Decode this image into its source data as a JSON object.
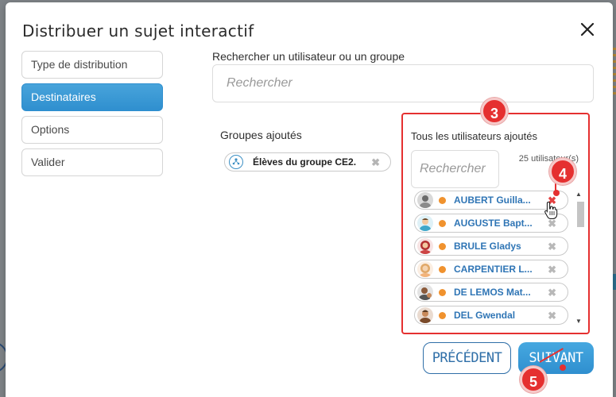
{
  "modal": {
    "title": "Distribuer un sujet interactif"
  },
  "steps": [
    {
      "label": "Type de distribution",
      "active": false
    },
    {
      "label": "Destinataires",
      "active": true
    },
    {
      "label": "Options",
      "active": false
    },
    {
      "label": "Valider",
      "active": false
    }
  ],
  "search": {
    "label": "Rechercher un utilisateur ou un groupe",
    "placeholder": "Rechercher"
  },
  "groups": {
    "label": "Groupes ajoutés",
    "items": [
      {
        "name": "Élèves du groupe CE2."
      }
    ]
  },
  "users": {
    "label": "Tous les utilisateurs ajoutés",
    "search_placeholder": "Rechercher",
    "count": "25 utilisateur(s)",
    "items": [
      {
        "name": "AUBERT Guilla...",
        "status_color": "#f0922e"
      },
      {
        "name": "AUGUSTE Bapt...",
        "status_color": "#f0922e"
      },
      {
        "name": "BRULE Gladys",
        "status_color": "#f0922e"
      },
      {
        "name": "CARPENTIER L...",
        "status_color": "#f0922e"
      },
      {
        "name": "DE LEMOS Mat...",
        "status_color": "#f0922e"
      },
      {
        "name": "DEL Gwendal",
        "status_color": "#f0922e"
      }
    ]
  },
  "annotations": {
    "badge_3": "3",
    "badge_4": "4",
    "badge_5": "5"
  },
  "footer": {
    "prev_label": "PRÉCÉDENT",
    "next_label": "SUIVANT"
  },
  "colors": {
    "accent": "#2f8fcf",
    "annotation": "#e53030",
    "status": "#f0922e",
    "user_name": "#2f75b5"
  }
}
